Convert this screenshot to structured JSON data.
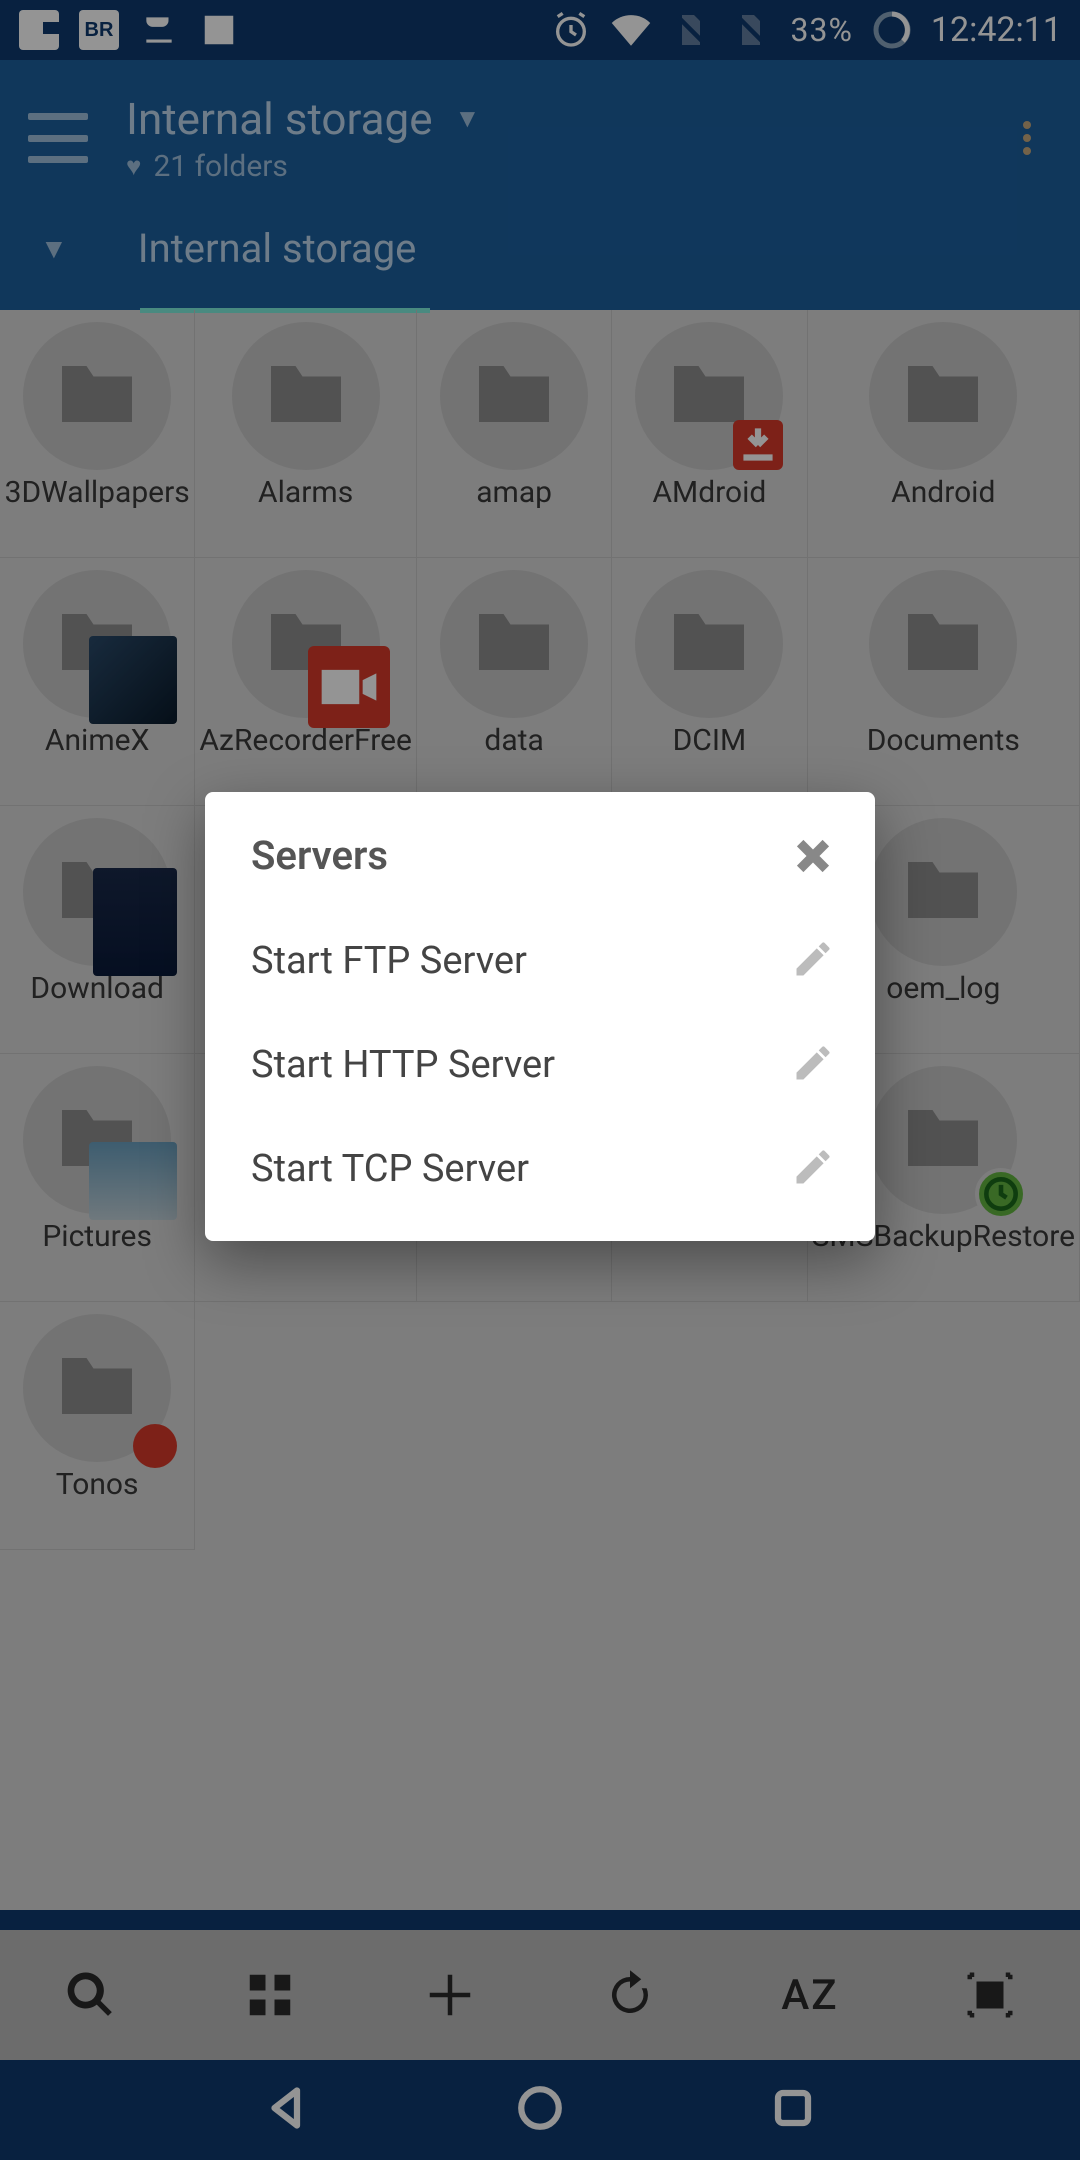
{
  "statusbar": {
    "battery": "33%",
    "time": "12:42:11"
  },
  "appbar": {
    "title": "Internal storage",
    "subtitle": "21 folders",
    "tab": "Internal storage"
  },
  "folders": [
    {
      "label": "3DWallpapers"
    },
    {
      "label": "Alarms"
    },
    {
      "label": "amap"
    },
    {
      "label": "AMdroid"
    },
    {
      "label": "Android"
    },
    {
      "label": "AnimeX"
    },
    {
      "label": "AzRecorderFree"
    },
    {
      "label": "data"
    },
    {
      "label": "DCIM"
    },
    {
      "label": "Documents"
    },
    {
      "label": "Download"
    },
    {
      "label": "oem_log"
    },
    {
      "label": "Pictures"
    },
    {
      "label": "SMSBackupRestore"
    },
    {
      "label": "Tonos"
    }
  ],
  "toolbar": {
    "sort": "AZ"
  },
  "dialog": {
    "title": "Servers",
    "items": [
      {
        "label": "Start FTP Server"
      },
      {
        "label": "Start HTTP Server"
      },
      {
        "label": "Start TCP Server"
      }
    ]
  }
}
